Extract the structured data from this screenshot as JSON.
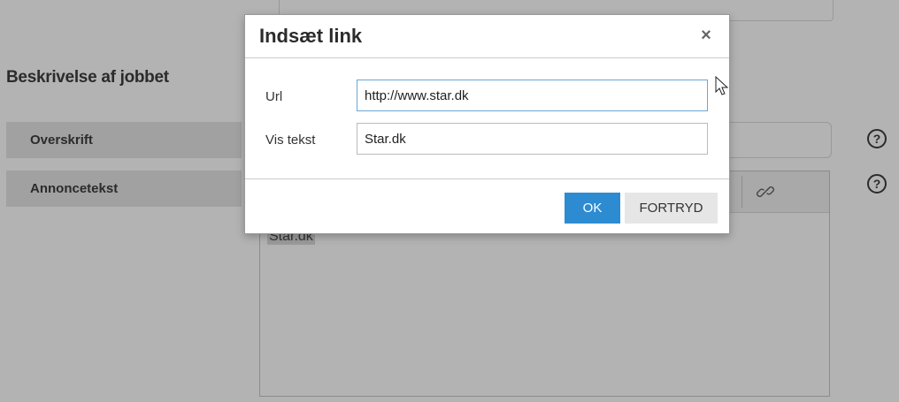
{
  "background": {
    "section_heading": "Beskrivelse af jobbet",
    "fields": [
      {
        "label": "Overskrift"
      },
      {
        "label": "Annoncetekst"
      }
    ],
    "help_icon_glyph": "?",
    "editor_content": "Star.dk"
  },
  "dialog": {
    "title": "Indsæt link",
    "close_glyph": "×",
    "url": {
      "label": "Url",
      "value": "http://www.star.dk"
    },
    "display_text": {
      "label": "Vis tekst",
      "value": "Star.dk"
    },
    "ok_label": "OK",
    "cancel_label": "FORTRYD"
  },
  "colors": {
    "primary_button": "#2d8bd1",
    "overlay": "#b3b3b3"
  }
}
